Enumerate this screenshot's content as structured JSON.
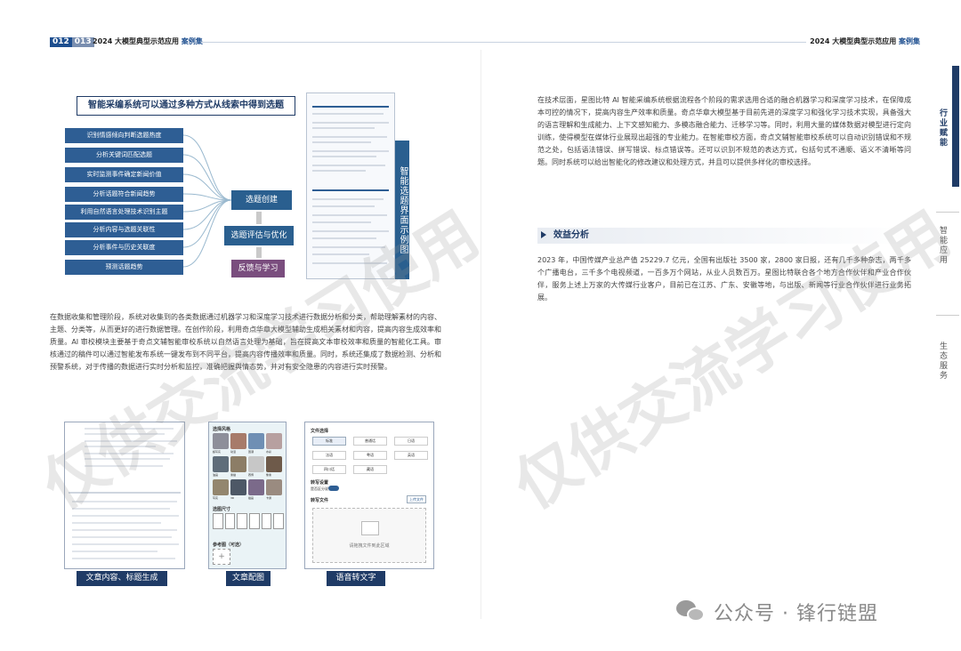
{
  "header": {
    "page_left": "012",
    "page_right": "013",
    "title_main": "2024 大模型典型示范应用 ",
    "title_accent": "案例集"
  },
  "diagram": {
    "title": "智能采编系统可以通过多种方式从线索中得到选题",
    "sources": [
      "识别情感倾向判断选题热度",
      "分析关键词匹配选题",
      "实时监测事件确定新闻价值",
      "分析话题符合新闻趋势",
      "利用自然语言处理技术识别主题",
      "分析内容与选题关联性",
      "分析事件与历史关联度",
      "预测话题趋势"
    ],
    "flow": {
      "create": "选题创建",
      "eval": "选题评估与优化",
      "feedback": "反馈与学习"
    },
    "side_tag": "智能选题界面示例图"
  },
  "paragraphs": {
    "left": "在数据收集和管理阶段，系统对收集到的各类数据通过机器学习和深度学习技术进行数据分析和分类，帮助理解素材的内容、主题、分类等，从而更好的进行数据管理。在创作阶段，利用奇点华章大模型辅助生成相关素材和内容，提高内容生成效率和质量。AI 审校模块主要基于奇点文辅智能审校系统以自然语言处理为基础，旨在提高文本审校效率和质量的智能化工具。审核通过的稿件可以通过智能发布系统一键发布到不同平台，提高内容传播效率和质量。同时，系统还集成了数据检测、分析和预警系统，对于传播的数据进行实时分析和监控，准确把握舆情态势，并对有安全隐患的内容进行实时预警。",
    "right1": "在技术层面，星图比特 AI 智能采编系统根据流程各个阶段的需求选用合适的融合机器学习和深度学习技术，在保障成本可控的情况下，提高内容生产效率和质量。奇点华章大模型基于目前先进的深度学习和强化学习技术实现，具备强大的语言理解和生成能力、上下文感知能力、多模态融合能力、迁移学习等。同时，利用大量的媒体数据对模型进行定向训练，使得模型在媒体行业展现出超强的专业能力。在智能审校方面，奇点文辅智能审校系统可以自动识别错误和不规范之处，包括语法错误、拼写错误、标点错误等。还可以识别不规范的表达方式，包括句式不通顺、语义不清晰等问题。同时系统可以给出智能化的修改建议和处理方式，并且可以提供多样化的审校选择。",
    "right2": "2023 年，中国传媒产业总产值 25229.7 亿元，全国有出版社 3500 家，2800 家日报，还有几千多种杂志，两千多个广播电台，三千多个电视频道，一百多万个网站，从业人员数百万。星图比特联合各个地方合作伙伴和产业合作伙伴，服务上述上万家的大传媒行业客户，目前已在江苏、广东、安徽等地，与出版、新闻等行业合作伙伴进行业务拓展。"
  },
  "section": {
    "title": "效益分析"
  },
  "screenshots": {
    "captions": [
      "文章内容、标题生成",
      "文章配图",
      "语音转文字"
    ],
    "voice": {
      "heading": "文件选择",
      "buttons": [
        "标准",
        "普通话",
        "日语",
        "法语",
        "粤语",
        "英语",
        "四川话",
        "藏语"
      ],
      "label1": "转写设置",
      "toggle_label": "是否区分说话人",
      "label2": "转写文件",
      "upload_link": "上传文件",
      "drop_text": "请拖拽文件到此区域"
    },
    "image": {
      "heading": "选择风格",
      "size_label": "选图尺寸",
      "count_label": "参考图（可选）",
      "style_labels": [
        "超写实",
        "动漫",
        "国潮",
        "水彩",
        "油画",
        "素描",
        "赛博",
        "像素",
        "写实",
        "3D",
        "插画",
        "卡通"
      ]
    }
  },
  "tabs": {
    "items": [
      "行业赋能",
      "智能应用",
      "生态服务"
    ]
  },
  "footer": {
    "text": "公众号 · 锋行链盟"
  },
  "watermark": "仅供交流学习使用",
  "colors": {
    "accent": "#1f3b66",
    "box": "#2e5e94",
    "feedback": "#7a4d7e"
  }
}
